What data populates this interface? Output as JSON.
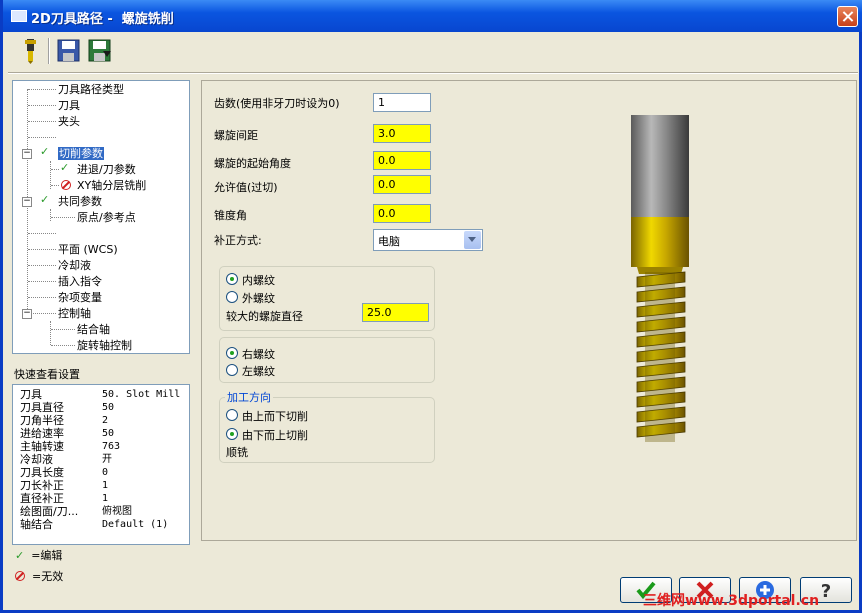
{
  "window": {
    "title": "2D刀具路径 -  螺旋铣削"
  },
  "tree": {
    "items": [
      {
        "label": "刀具路径类型"
      },
      {
        "label": "刀具"
      },
      {
        "label": "夹头"
      },
      {
        "label": ""
      },
      {
        "label": "切削参数"
      },
      {
        "label": "进退/刀参数"
      },
      {
        "label": "XY轴分层铣削"
      },
      {
        "label": "共同参数"
      },
      {
        "label": "原点/参考点"
      },
      {
        "label": ""
      },
      {
        "label": "平面 (WCS)"
      },
      {
        "label": "冷却液"
      },
      {
        "label": "插入指令"
      },
      {
        "label": "杂项变量"
      },
      {
        "label": "控制轴"
      },
      {
        "label": "结合轴"
      },
      {
        "label": "旋转轴控制"
      }
    ]
  },
  "quickview": {
    "title": "快速查看设置",
    "rows": [
      {
        "k": "刀具",
        "v": "50. Slot Mill"
      },
      {
        "k": "刀具直径",
        "v": "50"
      },
      {
        "k": "刀角半径",
        "v": "2"
      },
      {
        "k": "进给速率",
        "v": "50"
      },
      {
        "k": "主轴转速",
        "v": "763"
      },
      {
        "k": "冷却液",
        "v": "开"
      },
      {
        "k": "刀具长度",
        "v": "0"
      },
      {
        "k": "刀长补正",
        "v": "1"
      },
      {
        "k": "直径补正",
        "v": "1"
      },
      {
        "k": "绘图面/刀...",
        "v": "俯视图"
      },
      {
        "k": "轴结合",
        "v": "Default (1)"
      }
    ]
  },
  "legend": {
    "edit": "=编辑",
    "invalid": "=无效"
  },
  "params": {
    "teeth_label": "齿数(使用非牙刀时设为0)",
    "teeth_value": "1",
    "pitch_label": "螺旋间距",
    "pitch_value": "3.0",
    "start_angle_label": "螺旋的起始角度",
    "start_angle_value": "0.0",
    "allowance_label": "允许值(过切)",
    "allowance_value": "0.0",
    "taper_label": "锥度角",
    "taper_value": "0.0",
    "comp_label": "补正方式:",
    "comp_value": "电脑",
    "internal_thread": "内螺纹",
    "external_thread": "外螺纹",
    "major_dia_label": "较大的螺旋直径",
    "major_dia_value": "25.0",
    "right_thread": "右螺纹",
    "left_thread": "左螺纹",
    "direction_title": "加工方向",
    "top_down": "由上而下切削",
    "bottom_up": "由下而上切削",
    "climb": "顺铣"
  },
  "watermark": "三维网www.3dportal.cn",
  "colors": {
    "accent": "#0a55e0",
    "required_field": "#ffff00",
    "tool_gold": "#d6b400"
  }
}
